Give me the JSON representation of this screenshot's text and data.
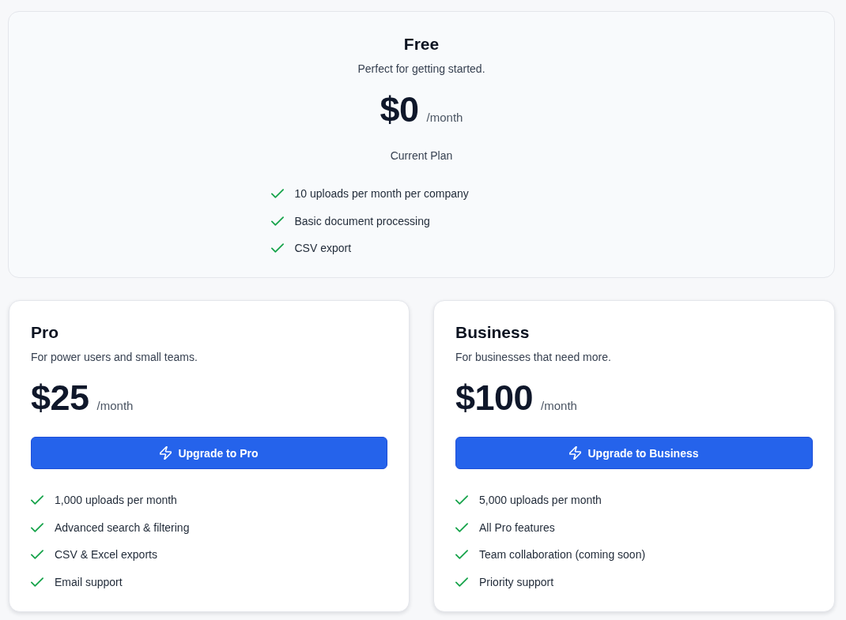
{
  "plans": [
    {
      "kind": "current",
      "name": "Free",
      "description": "Perfect for getting started.",
      "price": "$0",
      "period": "/month",
      "action_label": "Current Plan",
      "features": [
        "10 uploads per month per company",
        "Basic document processing",
        "CSV export"
      ]
    },
    {
      "kind": "upgrade",
      "name": "Pro",
      "description": "For power users and small teams.",
      "price": "$25",
      "period": "/month",
      "action_label": "Upgrade to Pro",
      "features": [
        "1,000 uploads per month",
        "Advanced search & filtering",
        "CSV & Excel exports",
        "Email support"
      ]
    },
    {
      "kind": "upgrade",
      "name": "Business",
      "description": "For businesses that need more.",
      "price": "$100",
      "period": "/month",
      "action_label": "Upgrade to Business",
      "features": [
        "5,000 uploads per month",
        "All Pro features",
        "Team collaboration (coming soon)",
        "Priority support"
      ]
    }
  ]
}
